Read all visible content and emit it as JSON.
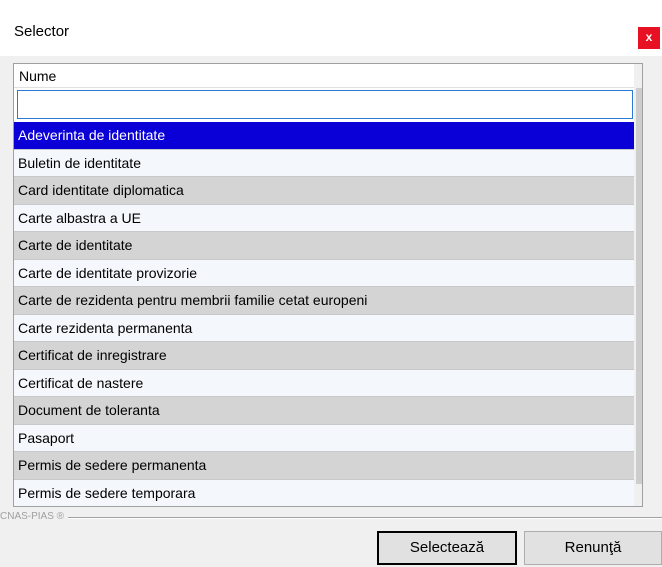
{
  "window": {
    "title": "Selector",
    "close_label": "x"
  },
  "grid": {
    "column_header": "Nume",
    "filter_value": "",
    "selected_index": 0,
    "rows": [
      "Adeverinta de identitate",
      "Buletin de identitate",
      "Card identitate diplomatica",
      "Carte albastra a UE",
      "Carte de identitate",
      "Carte de identitate provizorie",
      "Carte de rezidenta pentru membrii familie cetat europeni",
      "Carte rezidenta permanenta",
      "Certificat de inregistrare",
      "Certificat de nastere",
      "Document de toleranta",
      "Pasaport",
      "Permis de sedere permanenta",
      "Permis de sedere temporara"
    ],
    "scroll_up_icon": "chevron-up-icon",
    "scroll_down_icon": "chevron-down-icon"
  },
  "footer": {
    "group_label": "CNAS-PIAS ®"
  },
  "buttons": {
    "select_label": "Selectează",
    "cancel_label": "Renunţă"
  },
  "colors": {
    "selection": "#0a00d7",
    "close": "#e81123",
    "row_alt": "#d4d4d4",
    "row_light": "#f4f7fc"
  }
}
